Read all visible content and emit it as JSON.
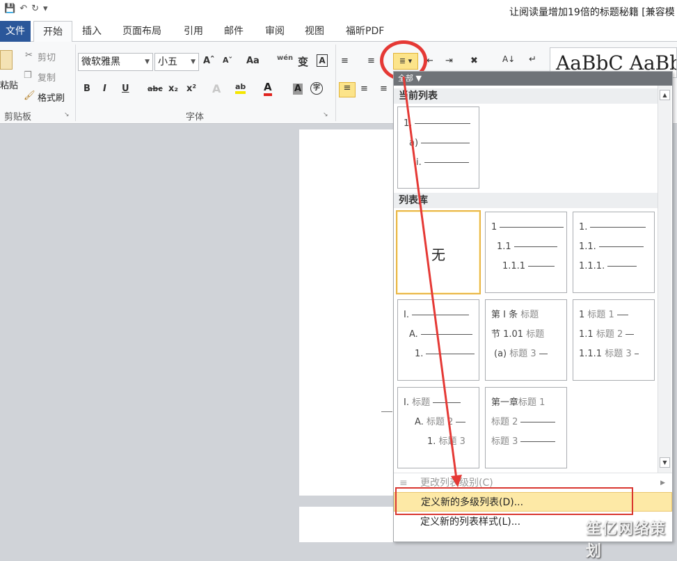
{
  "window": {
    "title": "让阅读量增加19倍的标题秘籍 [兼容模"
  },
  "qat": {
    "save_icon": "save-icon",
    "undo_icon": "undo-icon",
    "redo_icon": "redo-icon",
    "customize_icon": "customize-qat-icon"
  },
  "tabs": [
    {
      "label": "文件"
    },
    {
      "label": "开始"
    },
    {
      "label": "插入"
    },
    {
      "label": "页面布局"
    },
    {
      "label": "引用"
    },
    {
      "label": "邮件"
    },
    {
      "label": "审阅"
    },
    {
      "label": "视图"
    },
    {
      "label": "福昕PDF"
    }
  ],
  "clipboard": {
    "paste_label": "粘贴",
    "cut_label": "剪切",
    "copy_label": "复制",
    "format_painter_label": "格式刷",
    "group_label": "剪贴板"
  },
  "font": {
    "family": "微软雅黑",
    "size": "小五",
    "grow_label": "Aˆ",
    "shrink_label": "Aˇ",
    "change_case_label": "Aa",
    "phonetic_label": "wén",
    "char_border_label": "变",
    "char_box_label": "A",
    "bold_label": "B",
    "italic_label": "I",
    "underline_label": "U",
    "strike_label": "abc",
    "sub_label": "x₂",
    "sup_label": "x²",
    "effects_label": "A",
    "highlight_label": "ab",
    "color_label": "A",
    "shading_label": "A",
    "enclose_label": "字",
    "group_label": "字体"
  },
  "styles": {
    "preview_text": "AaBbC AaBb"
  },
  "dropdown": {
    "header": "全部",
    "current_list_title": "当前列表",
    "current_list": [
      "1.",
      "a)",
      "i."
    ],
    "library_title": "列表库",
    "none_label": "无",
    "thumbs": {
      "t2": [
        "1",
        "1.1",
        "1.1.1"
      ],
      "t3": [
        "1.",
        "1.1.",
        "1.1.1."
      ],
      "t4": [
        "I.",
        "A.",
        "1."
      ],
      "t5": [
        {
          "num": "第 I 条",
          "text": "标题"
        },
        {
          "num": "节 1.01",
          "text": "标题"
        },
        {
          "num": "(a)",
          "text": "标题 3"
        }
      ],
      "t6": [
        {
          "num": "1",
          "text": "标题 1"
        },
        {
          "num": "1.1",
          "text": "标题 2"
        },
        {
          "num": "1.1.1",
          "text": "标题 3"
        }
      ],
      "t7": [
        {
          "num": "I.",
          "text": "标题"
        },
        {
          "num": "A.",
          "text": "标题 2"
        },
        {
          "num": "1.",
          "text": "标题 3"
        }
      ],
      "t8": [
        {
          "num": "第一章",
          "text": "标题 1"
        },
        {
          "num": "",
          "text": "标题 2"
        },
        {
          "num": "",
          "text": "标题 3"
        }
      ]
    },
    "menu": {
      "change_level": "更改列表级别(C)",
      "define_multilevel": "定义新的多级列表(D)...",
      "define_style": "定义新的列表样式(L)..."
    }
  },
  "watermark": "笙亿网络策划",
  "colors": {
    "accent": "#2b579a",
    "highlight": "#fde9a6",
    "annotation_red": "#e53935"
  }
}
